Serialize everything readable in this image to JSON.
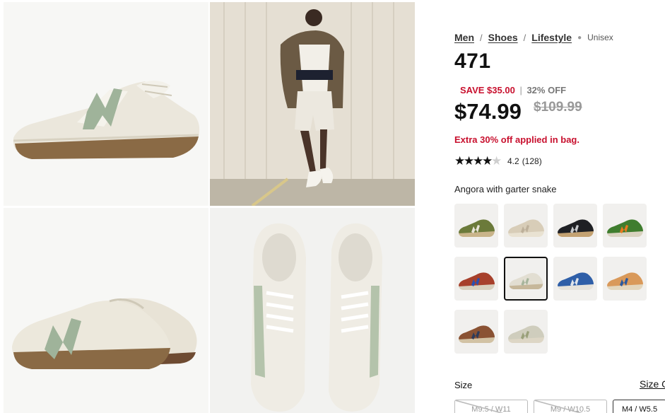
{
  "breadcrumb": {
    "items": [
      "Men",
      "Shoes",
      "Lifestyle"
    ],
    "separator": "/",
    "tag": "Unisex"
  },
  "product": {
    "title": "471",
    "save_amount": "SAVE $35.00",
    "save_divider": "|",
    "save_percent": "32% OFF",
    "price": "$74.99",
    "old_price": "$109.99",
    "promo": "Extra 30% off applied in bag."
  },
  "rating": {
    "value": "4.2",
    "count": "(128)",
    "stars_filled": 4,
    "stars_total": 5
  },
  "color": {
    "name": "Angora with garter snake",
    "swatches": [
      {
        "upper": "#6b7a3a",
        "logo": "#e8e4d8",
        "sole": "#c9b48a"
      },
      {
        "upper": "#d8cdb8",
        "logo": "#bdb09a",
        "sole": "#e9e2d2"
      },
      {
        "upper": "#1f2024",
        "logo": "#c7c9cc",
        "sole": "#c4a272"
      },
      {
        "upper": "#3f7d2e",
        "logo": "#e8791f",
        "sole": "#d9d2c0"
      },
      {
        "upper": "#a7402b",
        "logo": "#2a4fb0",
        "sole": "#d8cfbd"
      },
      {
        "upper": "#e2ded2",
        "logo": "#a7b59c",
        "sole": "#c6b79a"
      },
      {
        "upper": "#2f5fa8",
        "logo": "#dfe4ea",
        "sole": "#e6e3dc"
      },
      {
        "upper": "#d9995a",
        "logo": "#2c5a9e",
        "sole": "#e3d6bd"
      },
      {
        "upper": "#8a5233",
        "logo": "#2f3c5a",
        "sole": "#d2c2a4"
      },
      {
        "upper": "#cfcdbd",
        "logo": "#9aa07a",
        "sole": "#ddd6c5"
      }
    ],
    "selected_index": 5
  },
  "size": {
    "label": "Size",
    "guide": "Size Guide",
    "options": [
      "M9.5 / W11",
      "M9 / W10.5",
      "M4 / W5.5"
    ]
  },
  "colors": {
    "sale_red": "#c8102e",
    "shoe_green": "#9fb39a",
    "shoe_cream": "#ece8dc"
  }
}
